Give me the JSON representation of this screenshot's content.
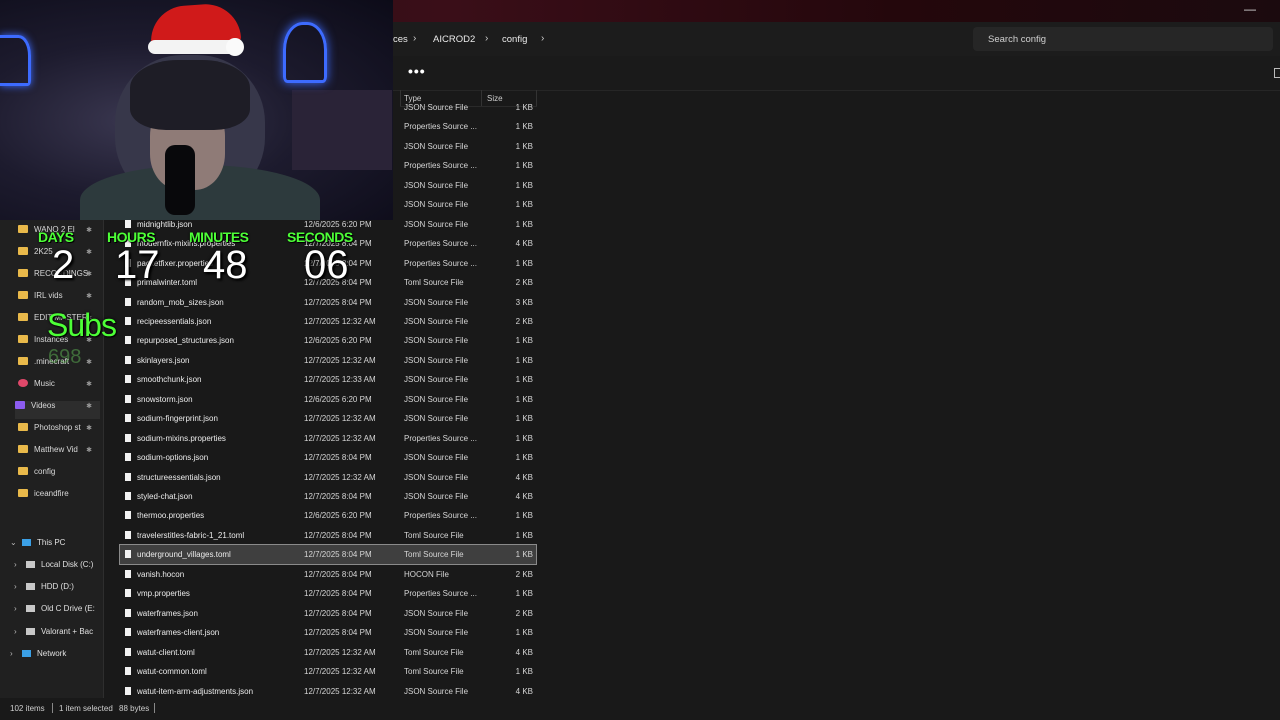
{
  "window": {
    "breadcrumbs": [
      "ces",
      "AICROD2",
      "config"
    ],
    "search_placeholder": "Search config",
    "more_label": "•••",
    "minimize_label": "—"
  },
  "columns": {
    "type": "Type",
    "size": "Size"
  },
  "webcam": {
    "countdown_labels": {
      "days": "DAYS",
      "hours": "HOURS",
      "minutes": "MINUTES",
      "seconds": "SECONDS"
    },
    "countdown_values": {
      "days": "2",
      "hours": "17",
      "minutes": "48",
      "seconds": "06"
    },
    "subs_label": "Subs",
    "subs_count": "698"
  },
  "sidebar": {
    "quick_access": [
      {
        "label": "WANO 2 El",
        "icon": "folder-icon",
        "pinned": true
      },
      {
        "label": "2K25",
        "icon": "folder-icon",
        "pinned": true
      },
      {
        "label": "RECORDINGS",
        "icon": "folder-icon",
        "pinned": true
      },
      {
        "label": "IRL vids",
        "icon": "folder-icon",
        "pinned": true
      },
      {
        "label": "EDIT MASTER",
        "icon": "folder-icon",
        "pinned": true
      },
      {
        "label": "Instances",
        "icon": "folder-icon",
        "pinned": true
      },
      {
        "label": ".minecraft",
        "icon": "folder-icon",
        "pinned": true
      },
      {
        "label": "Music",
        "icon": "music-icon",
        "pinned": true
      },
      {
        "label": "Videos",
        "icon": "video-icon",
        "pinned": true,
        "selected": true
      },
      {
        "label": "Photoshop st",
        "icon": "folder-icon",
        "pinned": true
      },
      {
        "label": "Matthew Vid",
        "icon": "folder-icon",
        "pinned": true
      },
      {
        "label": "config",
        "icon": "folder-icon",
        "pinned": false
      },
      {
        "label": "iceandfire",
        "icon": "folder-icon",
        "pinned": false
      }
    ],
    "tree": [
      {
        "label": "This PC",
        "expanded": true,
        "icon": "pc-icon"
      },
      {
        "label": "Local Disk (C:)",
        "icon": "drive-icon"
      },
      {
        "label": "HDD (D:)",
        "icon": "drive-icon"
      },
      {
        "label": "Old C Drive (E:",
        "icon": "drive-icon"
      },
      {
        "label": "Valorant + Bac",
        "icon": "drive-icon"
      },
      {
        "label": "Network",
        "icon": "network-icon"
      }
    ]
  },
  "files": [
    {
      "name": "",
      "date": "",
      "type": "JSON Source File",
      "size": "1 KB"
    },
    {
      "name": "",
      "date": "",
      "type": "Properties Source ...",
      "size": "1 KB"
    },
    {
      "name": "",
      "date": "",
      "type": "JSON Source File",
      "size": "1 KB"
    },
    {
      "name": "",
      "date": "",
      "type": "Properties Source ...",
      "size": "1 KB"
    },
    {
      "name": "",
      "date": "",
      "type": "JSON Source File",
      "size": "1 KB"
    },
    {
      "name": "",
      "date": "",
      "type": "JSON Source File",
      "size": "1 KB"
    },
    {
      "name": "midnightlib.json",
      "date": "12/6/2025 6:20 PM",
      "type": "JSON Source File",
      "size": "1 KB"
    },
    {
      "name": "modernfix-mixins.properties",
      "date": "12/7/2025 8:04 PM",
      "type": "Properties Source ...",
      "size": "4 KB"
    },
    {
      "name": "packetfixer.properties",
      "date": "12/7/2025 8:04 PM",
      "type": "Properties Source ...",
      "size": "1 KB"
    },
    {
      "name": "primalwinter.toml",
      "date": "12/7/2025 8:04 PM",
      "type": "Toml Source File",
      "size": "2 KB"
    },
    {
      "name": "random_mob_sizes.json",
      "date": "12/7/2025 8:04 PM",
      "type": "JSON Source File",
      "size": "3 KB"
    },
    {
      "name": "recipeessentials.json",
      "date": "12/7/2025 12:32 AM",
      "type": "JSON Source File",
      "size": "2 KB"
    },
    {
      "name": "repurposed_structures.json",
      "date": "12/6/2025 6:20 PM",
      "type": "JSON Source File",
      "size": "1 KB"
    },
    {
      "name": "skinlayers.json",
      "date": "12/7/2025 12:32 AM",
      "type": "JSON Source File",
      "size": "1 KB"
    },
    {
      "name": "smoothchunk.json",
      "date": "12/7/2025 12:33 AM",
      "type": "JSON Source File",
      "size": "1 KB"
    },
    {
      "name": "snowstorm.json",
      "date": "12/6/2025 6:20 PM",
      "type": "JSON Source File",
      "size": "1 KB"
    },
    {
      "name": "sodium-fingerprint.json",
      "date": "12/7/2025 12:32 AM",
      "type": "JSON Source File",
      "size": "1 KB"
    },
    {
      "name": "sodium-mixins.properties",
      "date": "12/7/2025 12:32 AM",
      "type": "Properties Source ...",
      "size": "1 KB"
    },
    {
      "name": "sodium-options.json",
      "date": "12/7/2025 8:04 PM",
      "type": "JSON Source File",
      "size": "1 KB"
    },
    {
      "name": "structureessentials.json",
      "date": "12/7/2025 12:32 AM",
      "type": "JSON Source File",
      "size": "4 KB"
    },
    {
      "name": "styled-chat.json",
      "date": "12/7/2025 8:04 PM",
      "type": "JSON Source File",
      "size": "4 KB"
    },
    {
      "name": "thermoo.properties",
      "date": "12/6/2025 6:20 PM",
      "type": "Properties Source ...",
      "size": "1 KB"
    },
    {
      "name": "travelerstitles-fabric-1_21.toml",
      "date": "12/7/2025 8:04 PM",
      "type": "Toml Source File",
      "size": "1 KB"
    },
    {
      "name": "underground_villages.toml",
      "date": "12/7/2025 8:04 PM",
      "type": "Toml Source File",
      "size": "1 KB",
      "selected": true
    },
    {
      "name": "vanish.hocon",
      "date": "12/7/2025 8:04 PM",
      "type": "HOCON File",
      "size": "2 KB"
    },
    {
      "name": "vmp.properties",
      "date": "12/7/2025 8:04 PM",
      "type": "Properties Source ...",
      "size": "1 KB"
    },
    {
      "name": "waterframes.json",
      "date": "12/7/2025 8:04 PM",
      "type": "JSON Source File",
      "size": "2 KB"
    },
    {
      "name": "waterframes-client.json",
      "date": "12/7/2025 8:04 PM",
      "type": "JSON Source File",
      "size": "1 KB"
    },
    {
      "name": "watut-client.toml",
      "date": "12/7/2025 12:32 AM",
      "type": "Toml Source File",
      "size": "4 KB"
    },
    {
      "name": "watut-common.toml",
      "date": "12/7/2025 12:32 AM",
      "type": "Toml Source File",
      "size": "1 KB"
    },
    {
      "name": "watut-item-arm-adjustments.json",
      "date": "12/7/2025 12:32 AM",
      "type": "JSON Source File",
      "size": "4 KB"
    }
  ],
  "status": {
    "items": "102 items",
    "selection": "1 item selected",
    "size": "88 bytes"
  },
  "colors": {
    "accent_green": "#4dff37",
    "neon_blue": "#3d6bff",
    "folder": "#e9b94a",
    "selection": "#3f3f3f"
  }
}
